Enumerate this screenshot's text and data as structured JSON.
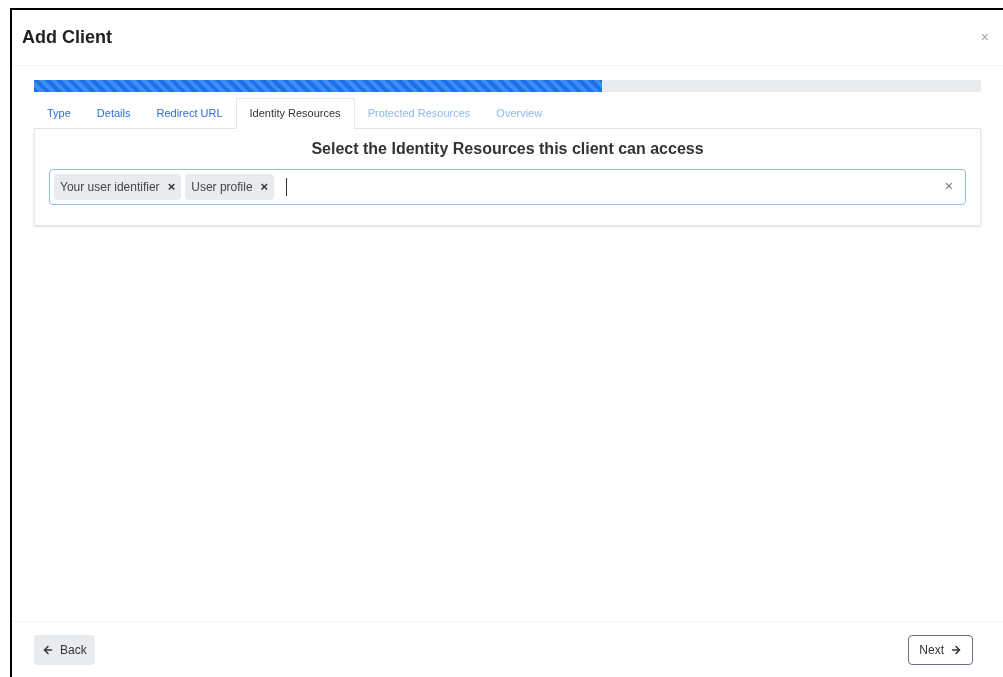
{
  "dialog": {
    "title": "Add Client",
    "close": "×"
  },
  "progress": {
    "level": 0.6
  },
  "tabs": [
    {
      "label": "Type",
      "selected": false,
      "disabled": false
    },
    {
      "label": "Details",
      "selected": false,
      "disabled": false
    },
    {
      "label": "Redirect URL",
      "selected": false,
      "disabled": false
    },
    {
      "label": "Identity Resources",
      "selected": true,
      "disabled": false
    },
    {
      "label": "Protected Resources",
      "selected": false,
      "disabled": true
    },
    {
      "label": "Overview",
      "selected": false,
      "disabled": true
    }
  ],
  "panel": {
    "heading": "Select the Identity Resources this client can access",
    "tags": [
      {
        "label": "Your user identifier",
        "remove": "×"
      },
      {
        "label": "User profile",
        "remove": "×"
      }
    ],
    "clear": "×"
  },
  "footer": {
    "back": "Back",
    "next": "Next"
  }
}
